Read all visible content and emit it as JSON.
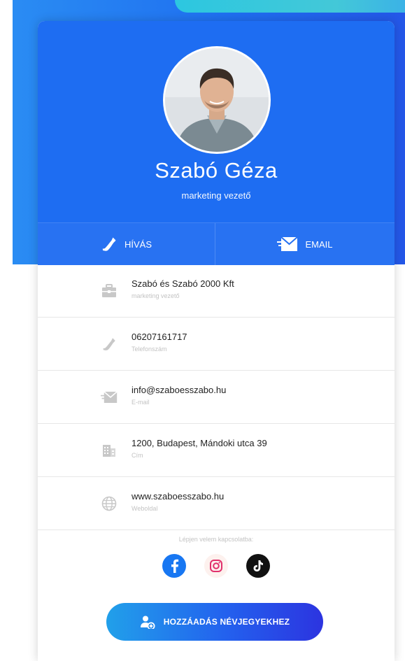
{
  "profile": {
    "name": "Szabó Géza",
    "title": "marketing vezető"
  },
  "actions": {
    "call_label": "HÍVÁS",
    "email_label": "EMAIL"
  },
  "contacts": [
    {
      "icon": "briefcase-icon",
      "primary": "Szabó és Szabó 2000 Kft",
      "secondary": "marketing vezető"
    },
    {
      "icon": "phone-icon",
      "primary": "06207161717",
      "secondary": "Telefonszám"
    },
    {
      "icon": "envelope-icon",
      "primary": "info@szaboesszabo.hu",
      "secondary": "E-mail"
    },
    {
      "icon": "building-icon",
      "primary": "1200, Budapest, Mándoki utca 39",
      "secondary": "Cím"
    },
    {
      "icon": "globe-icon",
      "primary": "www.szaboesszabo.hu",
      "secondary": "Weboldal"
    }
  ],
  "social": {
    "caption": "Lépjen velem kapcsolatba:",
    "items": [
      "facebook-icon",
      "instagram-icon",
      "tiktok-icon"
    ]
  },
  "add_button": {
    "label": "HOZZÁADÁS NÉVJEGYEKHEZ"
  },
  "colors": {
    "header_blue": "#1e6df2",
    "action_bar": "#2872f2",
    "icon_gray": "#c8c8c8"
  }
}
